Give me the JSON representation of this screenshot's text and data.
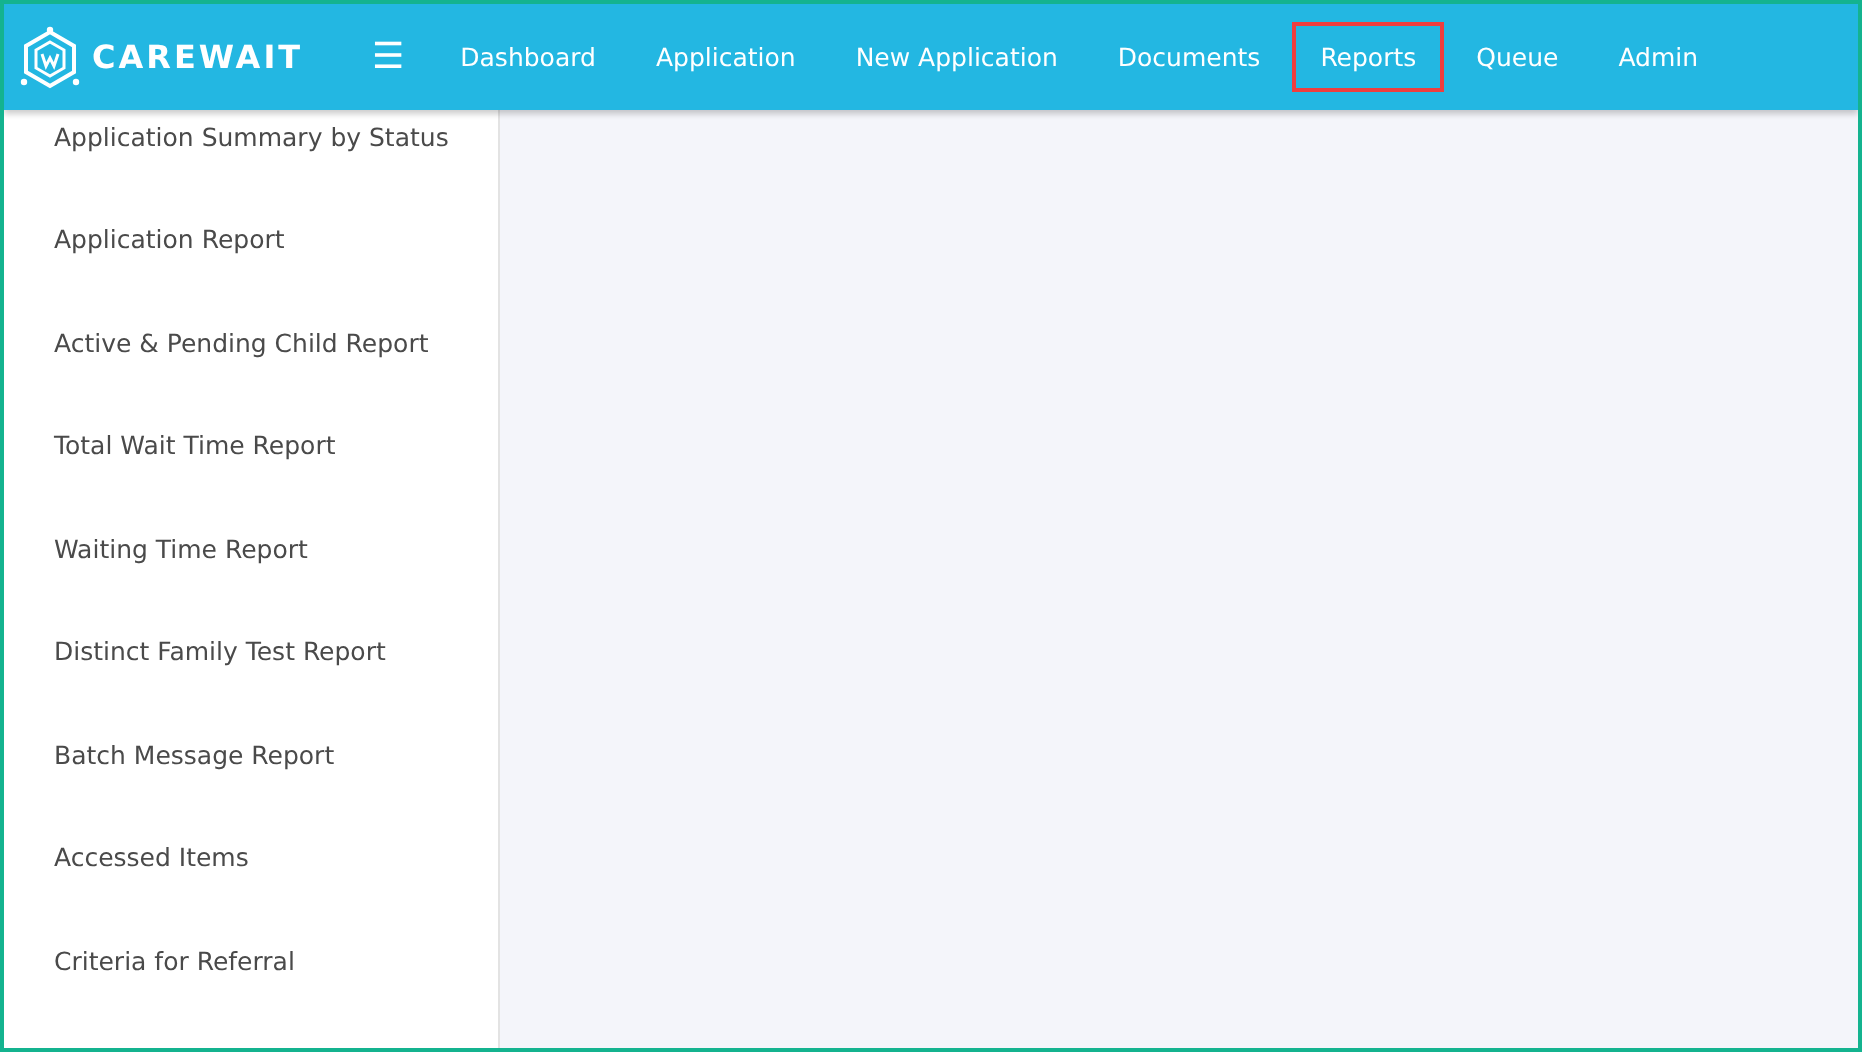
{
  "header": {
    "logo": "CAREWAIT",
    "menu_icon": "☰"
  },
  "nav": [
    {
      "label": "Dashboard",
      "selected": false
    },
    {
      "label": "Application",
      "selected": false
    },
    {
      "label": "New Application",
      "selected": false
    },
    {
      "label": "Documents",
      "selected": false
    },
    {
      "label": "Reports",
      "selected": true
    },
    {
      "label": "Queue",
      "selected": false
    },
    {
      "label": "Admin",
      "selected": false
    }
  ],
  "sidebar": {
    "items": [
      "Application Summary by Status",
      "Application Report",
      "Active & Pending Child Report",
      "Total Wait Time Report",
      "Waiting Time Report",
      "Distinct Family Test Report",
      "Batch Message Report",
      "Accessed Items",
      "Criteria for Referral"
    ]
  }
}
